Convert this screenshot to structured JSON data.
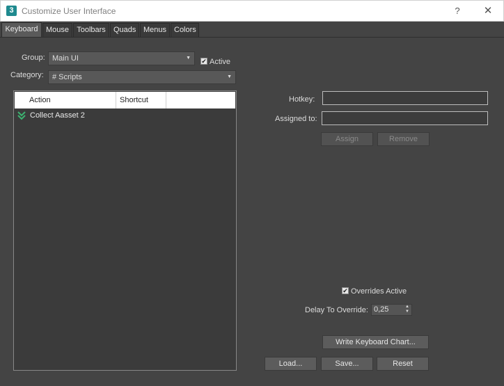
{
  "window": {
    "app_icon": "3",
    "title": "Customize User Interface",
    "help_label": "?",
    "close_label": "✕"
  },
  "tabs": [
    {
      "label": "Keyboard",
      "active": true
    },
    {
      "label": "Mouse"
    },
    {
      "label": "Toolbars"
    },
    {
      "label": "Quads"
    },
    {
      "label": "Menus"
    },
    {
      "label": "Colors"
    }
  ],
  "group": {
    "label": "Group:",
    "value": "Main UI"
  },
  "active_check": {
    "label": "Active",
    "checked": true
  },
  "category": {
    "label": "Category:",
    "value": "# Scripts"
  },
  "list": {
    "columns": [
      "Action",
      "Shortcut"
    ],
    "rows": [
      {
        "action": "Collect Aasset 2",
        "icon": "double-chevron-down-icon"
      }
    ]
  },
  "hotkey": {
    "label": "Hotkey:",
    "value": ""
  },
  "assigned_to": {
    "label": "Assigned to:",
    "value": ""
  },
  "buttons": {
    "assign": "Assign",
    "remove": "Remove",
    "write_chart": "Write Keyboard Chart...",
    "load": "Load...",
    "save": "Save...",
    "reset": "Reset"
  },
  "overrides": {
    "label": "Overrides Active",
    "checked": true
  },
  "delay": {
    "label": "Delay To Override:",
    "value": "0,25"
  },
  "colors": {
    "accent_icon": "#3cb371",
    "background": "#444444"
  }
}
